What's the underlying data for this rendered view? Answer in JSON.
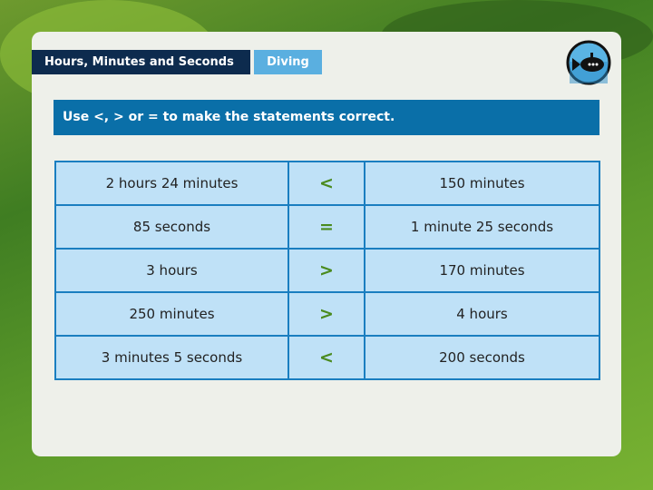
{
  "tabs": [
    {
      "label": "Hours, Minutes and Seconds"
    },
    {
      "label": "Diving"
    }
  ],
  "badge_icon": "submarine-icon",
  "instruction": "Use <, > or = to make the statements correct.",
  "colors": {
    "tab_dark": "#0d2b4e",
    "tab_light": "#5aafe0",
    "instruction_bg": "#0a6fa8",
    "cell_bg": "#bfe1f7",
    "symbol": "#4a8a1e"
  },
  "rows": [
    {
      "left": "2 hours 24 minutes",
      "symbol": "<",
      "right": "150 minutes"
    },
    {
      "left": "85 seconds",
      "symbol": "=",
      "right": "1 minute 25 seconds"
    },
    {
      "left": "3 hours",
      "symbol": ">",
      "right": "170 minutes"
    },
    {
      "left": "250 minutes",
      "symbol": ">",
      "right": "4 hours"
    },
    {
      "left": "3 minutes 5 seconds",
      "symbol": "<",
      "right": "200 seconds"
    }
  ]
}
